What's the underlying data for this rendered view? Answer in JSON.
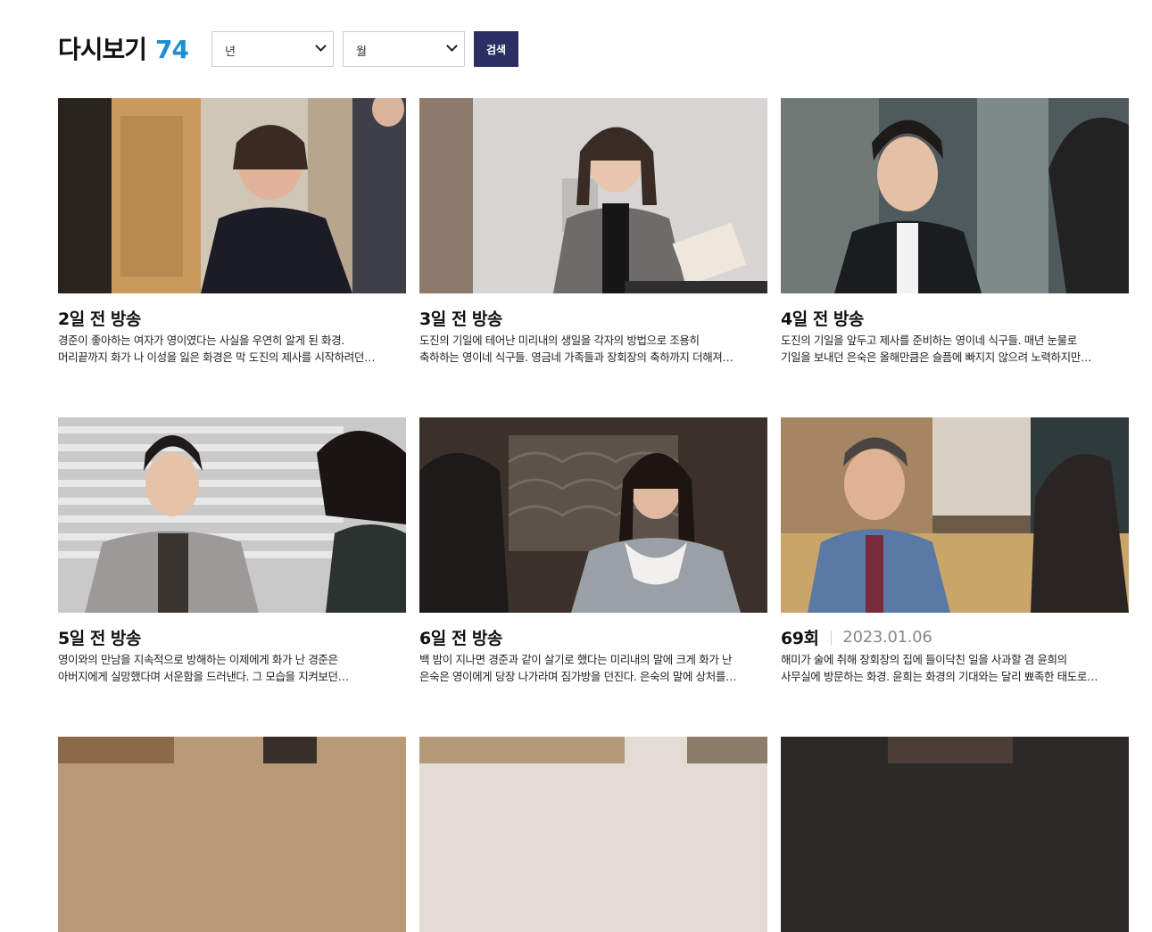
{
  "header": {
    "title": "다시보기",
    "count": "74"
  },
  "filters": {
    "year_label": "년",
    "month_label": "월",
    "search_label": "검색"
  },
  "episodes": [
    {
      "when": "2일 전 방송",
      "date": "",
      "line1": "경준이 좋아하는 여자가 영이였다는 사실을 우연히 알게 된 화경.",
      "line2": "머리끝까지 화가 나 이성을 잃은 화경은 막 도진의 제사를 시작하려던…"
    },
    {
      "when": "3일 전 방송",
      "date": "",
      "line1": "도진의 기일에 테어난 미리내의 생일을 각자의 방법으로 조용히",
      "line2": "축하하는 영이네 식구들. 영금네 가족들과 장회장의 축하까지 더해져…"
    },
    {
      "when": "4일 전 방송",
      "date": "",
      "line1": "도진의 기일을 앞두고 제사를 준비하는 영이네 식구들. 매년 눈물로",
      "line2": "기일을 보내던 은숙은 올해만큼은 슬픔에 빠지지 않으려 노력하지만…"
    },
    {
      "when": "5일 전 방송",
      "date": "",
      "line1": "영이와의 만남을 지속적으로 방해하는 이제에게 화가 난 경준은",
      "line2": "아버지에게 실망했다며 서운함을 드러낸다. 그 모습을 지켜보던…"
    },
    {
      "when": "6일 전 방송",
      "date": "",
      "line1": "백 밤이 지나면 경준과 같이 살기로 했다는 미리내의 말에 크게 화가 난",
      "line2": "은숙은 영이에게 당장 나가라며 짐가방을 던진다. 은숙의 말에 상처를…"
    },
    {
      "when": "69회",
      "date": "2023.01.06",
      "line1": "해미가 술에 취해 장회장의 집에 들이닥친 일을 사과할 겸 윤희의",
      "line2": "사무실에 방문하는 화경. 윤희는 화경의 기대와는 달리 뾰족한 태도로…"
    }
  ],
  "colors": {
    "accent": "#1b8fd1",
    "search_button": "#2b2e63"
  }
}
